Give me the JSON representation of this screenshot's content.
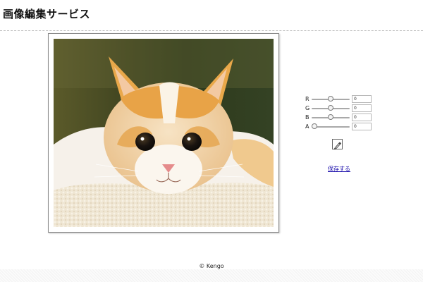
{
  "header": {
    "title": "画像編集サービス"
  },
  "image": {
    "subject": "orange and white cat lying on a fluffy cream cushion"
  },
  "controls": {
    "sliders": [
      {
        "label": "R",
        "value": "0",
        "level": 0.5
      },
      {
        "label": "G",
        "value": "0",
        "level": 0.5
      },
      {
        "label": "B",
        "value": "0",
        "level": 0.5
      },
      {
        "label": "A",
        "value": "0",
        "level": 0.0
      }
    ],
    "tool_icon": "pen-icon",
    "save_label": "保存する"
  },
  "footer": {
    "copyright": "© Kengo"
  },
  "colors": {
    "link": "#1a0dab",
    "rule": "#bcbcbc"
  }
}
